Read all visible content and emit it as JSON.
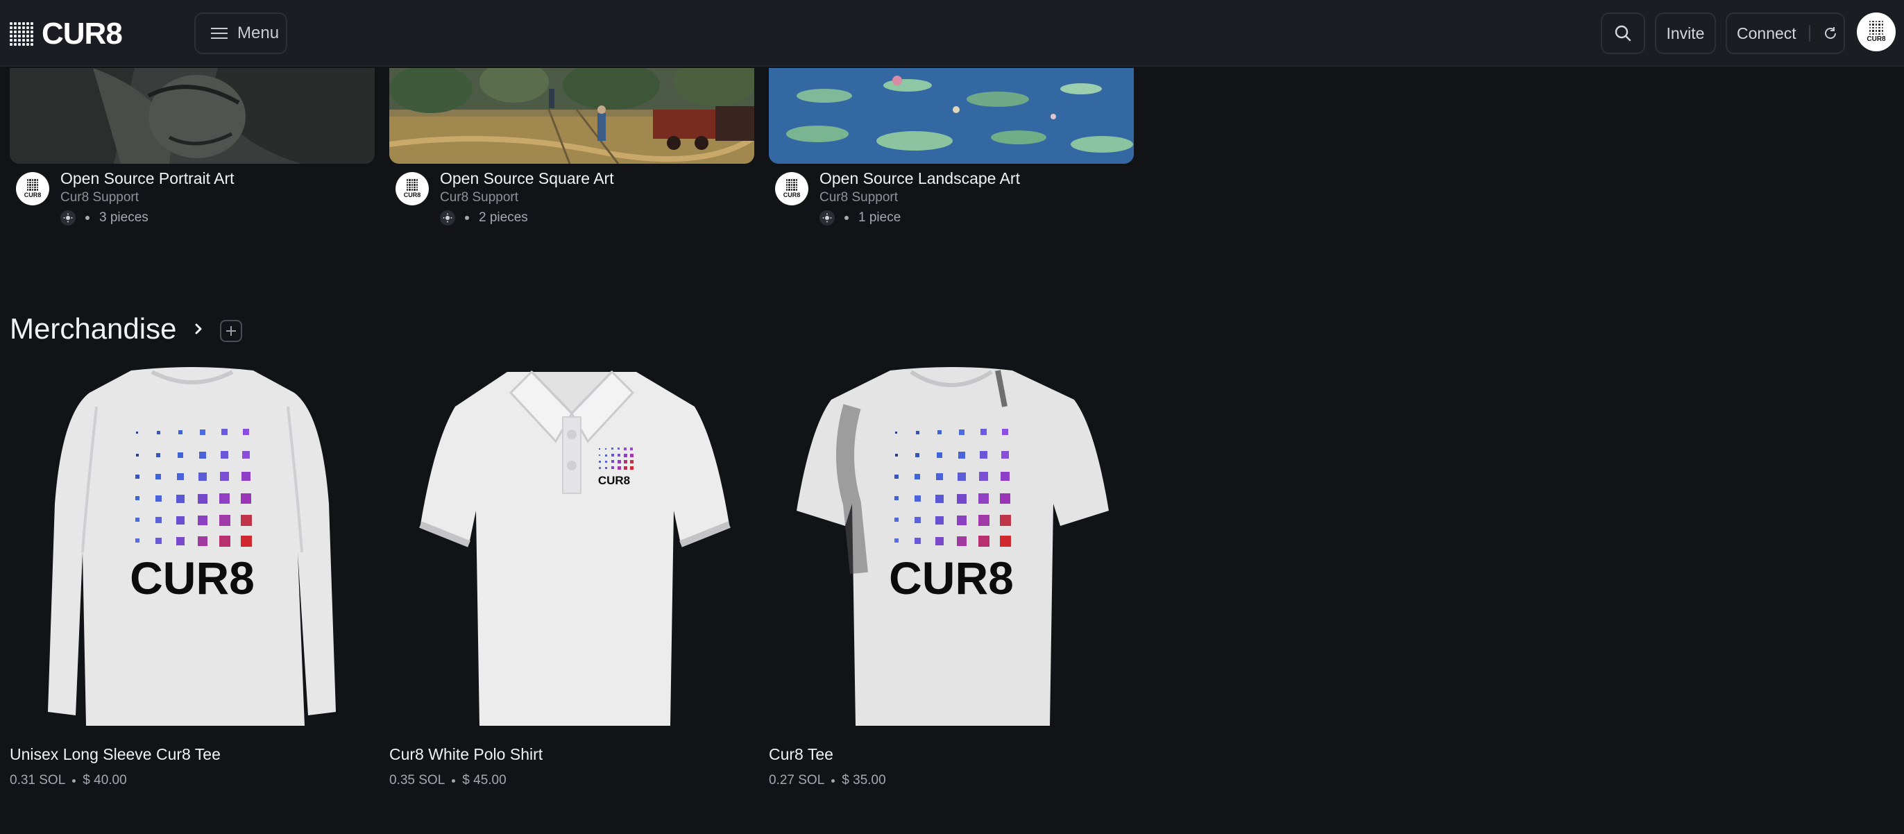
{
  "header": {
    "logo_text": "CUR8",
    "menu_label": "Menu",
    "invite_label": "Invite",
    "connect_label": "Connect"
  },
  "avatar_text": "CUR8",
  "collections": [
    {
      "title": "Open Source Portrait Art",
      "owner": "Cur8 Support",
      "count": "3 pieces"
    },
    {
      "title": "Open Source Square Art",
      "owner": "Cur8 Support",
      "count": "2 pieces"
    },
    {
      "title": "Open Source Landscape Art",
      "owner": "Cur8 Support",
      "count": "1 piece"
    }
  ],
  "merch_section": {
    "title": "Merchandise"
  },
  "products": [
    {
      "name": "Unisex Long Sleeve Cur8 Tee",
      "sol": "0.31 SOL",
      "usd": "$ 40.00",
      "print_text": "CUR8"
    },
    {
      "name": "Cur8 White Polo Shirt",
      "sol": "0.35 SOL",
      "usd": "$ 45.00",
      "print_text": "CUR8"
    },
    {
      "name": "Cur8 Tee",
      "sol": "0.27 SOL",
      "usd": "$ 35.00",
      "print_text": "CUR8"
    }
  ],
  "colors": {
    "background": "#121316",
    "header": "#1b1d22",
    "text": "#f1f2f4",
    "muted": "#8d9199"
  }
}
